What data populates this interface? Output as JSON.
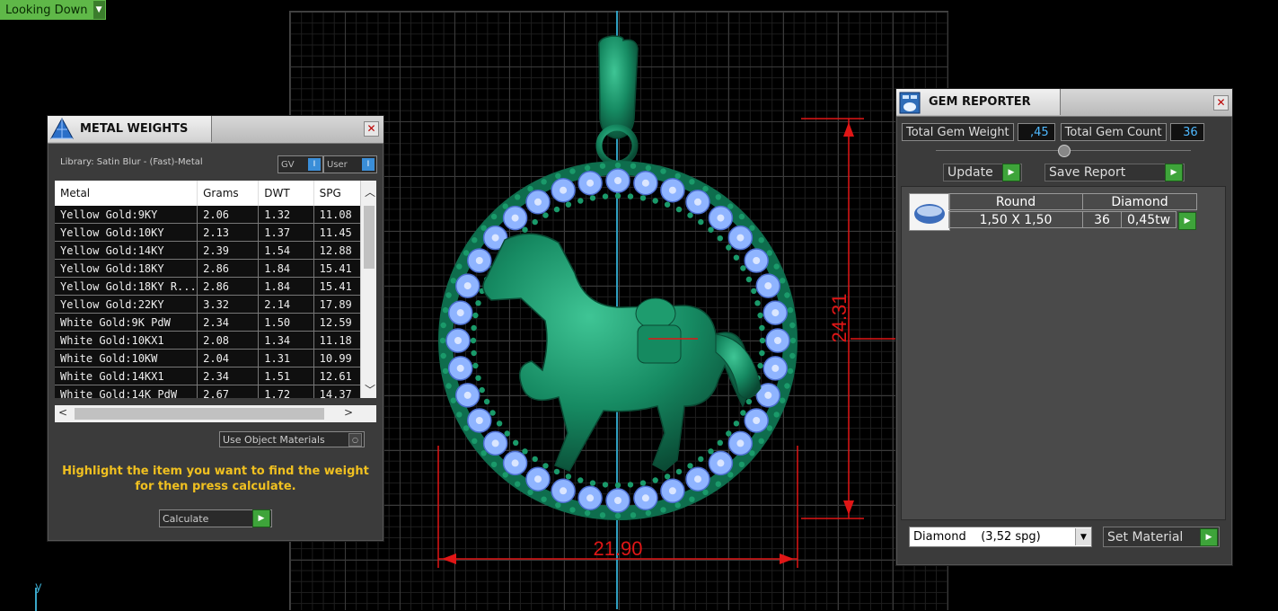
{
  "view_mode": {
    "label": "Looking Down"
  },
  "dimensions": {
    "height_label": "24.31",
    "width_label": "21.90"
  },
  "metal_weights": {
    "title": "METAL WEIGHTS",
    "library": "Library: Satin Blur - (Fast)-Metal",
    "gv_label": "GV",
    "user_label": "User",
    "columns": [
      "Metal",
      "Grams",
      "DWT",
      "SPG"
    ],
    "rows": [
      [
        "Yellow Gold:9KY",
        "2.06",
        "1.32",
        "11.08"
      ],
      [
        "Yellow Gold:10KY",
        "2.13",
        "1.37",
        "11.45"
      ],
      [
        "Yellow Gold:14KY",
        "2.39",
        "1.54",
        "12.88"
      ],
      [
        "Yellow Gold:18KY",
        "2.86",
        "1.84",
        "15.41"
      ],
      [
        "Yellow Gold:18KY R...",
        "2.86",
        "1.84",
        "15.41"
      ],
      [
        "Yellow Gold:22KY",
        "3.32",
        "2.14",
        "17.89"
      ],
      [
        "White Gold:9K PdW",
        "2.34",
        "1.50",
        "12.59"
      ],
      [
        "White Gold:10KX1",
        "2.08",
        "1.34",
        "11.18"
      ],
      [
        "White Gold:10KW",
        "2.04",
        "1.31",
        "10.99"
      ],
      [
        "White Gold:14KX1",
        "2.34",
        "1.51",
        "12.61"
      ],
      [
        "White Gold:14K PdW",
        "2.67",
        "1.72",
        "14.37"
      ]
    ],
    "use_object_materials": "Use Object Materials",
    "hint": "Highlight the item you want to find the weight for then press calculate.",
    "calculate_label": "Calculate"
  },
  "gem_reporter": {
    "title": "GEM REPORTER",
    "total_weight_label": "Total Gem Weight",
    "total_weight_value": ",45",
    "total_count_label": "Total Gem Count",
    "total_count_value": "36",
    "update_label": "Update",
    "save_report_label": "Save Report",
    "gem": {
      "shape": "Round",
      "material": "Diamond",
      "size": "1,50 X 1,50",
      "count": "36",
      "weight": "0,45tw"
    },
    "material_select": "Diamond    (3,52 spg)",
    "set_material_label": "Set Material"
  },
  "axis_label": "y",
  "colors": {
    "accent_green": "#3ea43a",
    "model_green": "#1d8a66",
    "gem_blue": "#8fb4ff",
    "dimension_red": "#e01616",
    "hint_yellow": "#f0c020"
  }
}
